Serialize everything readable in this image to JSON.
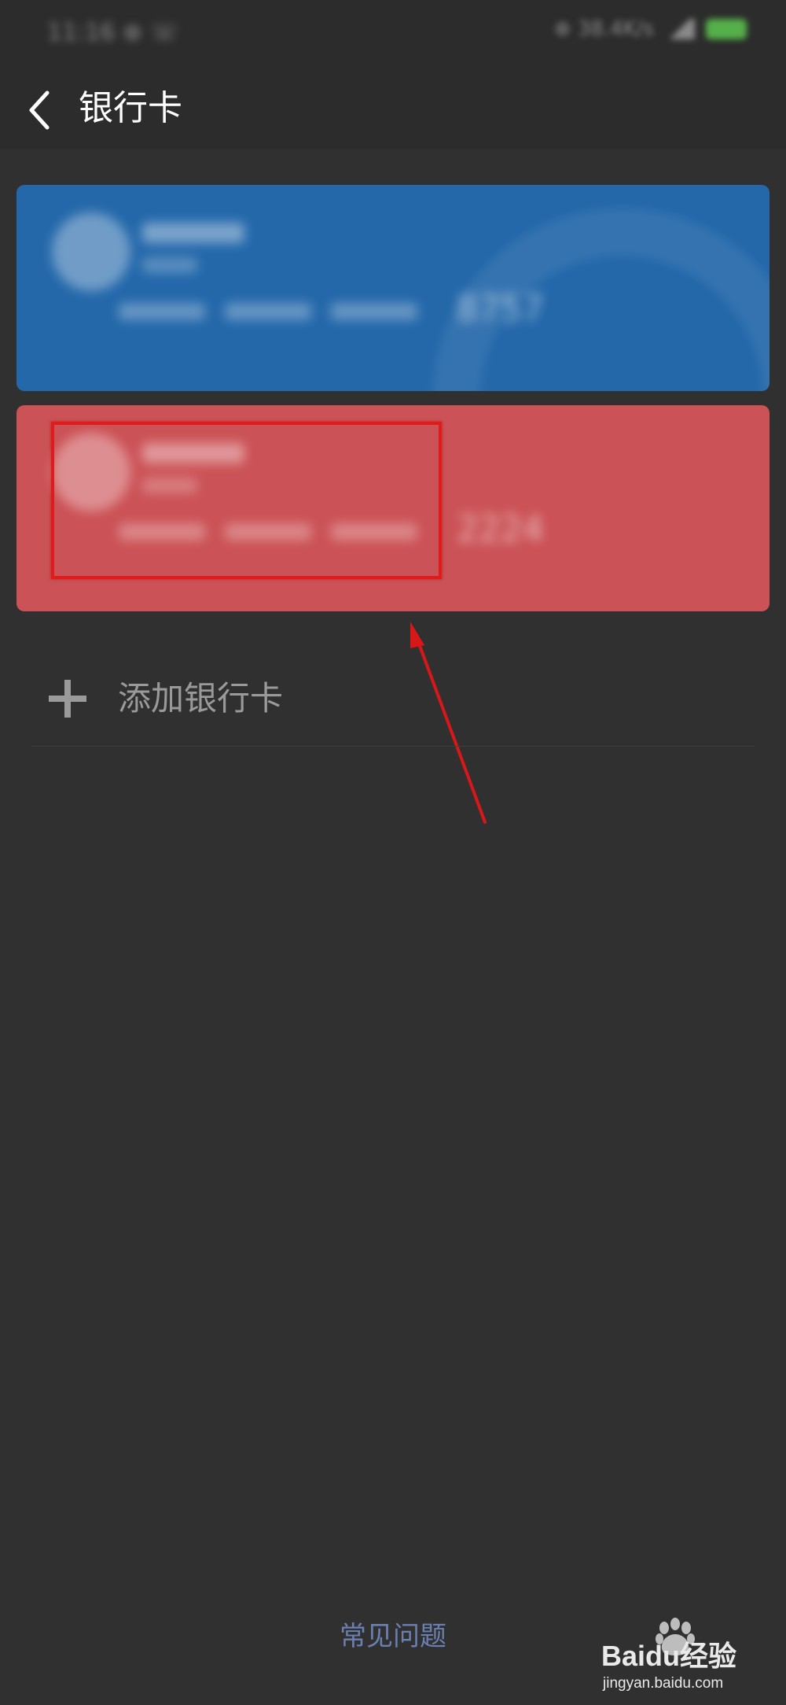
{
  "status_bar": {
    "time": "11:16 ⊕ ☏",
    "network": "⊕ 38.4K/s"
  },
  "header": {
    "title": "银行卡",
    "back_icon": "chevron-left-icon"
  },
  "cards": [
    {
      "color": "#2468aa",
      "digits": "8757"
    },
    {
      "color": "#cb5256",
      "digits": "2224"
    }
  ],
  "add_card": {
    "icon": "plus-icon",
    "label": "添加银行卡"
  },
  "footer": {
    "faq_label": "常见问题"
  },
  "annotation": {
    "highlight_color": "#e01b1b"
  },
  "watermark": {
    "brand": "Baidu经验",
    "url": "jingyan.baidu.com"
  }
}
